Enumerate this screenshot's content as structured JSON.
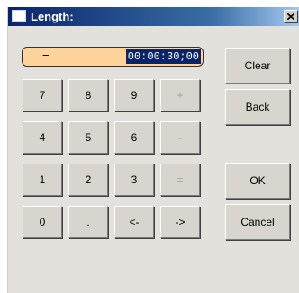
{
  "window": {
    "title": "Length:"
  },
  "display": {
    "operator": "=",
    "value": "00:00:30;00"
  },
  "keypad": {
    "row1": [
      {
        "label": "7",
        "enabled": true
      },
      {
        "label": "8",
        "enabled": true
      },
      {
        "label": "9",
        "enabled": true
      },
      {
        "label": "+",
        "enabled": false
      }
    ],
    "row2": [
      {
        "label": "4",
        "enabled": true
      },
      {
        "label": "5",
        "enabled": true
      },
      {
        "label": "6",
        "enabled": true
      },
      {
        "label": "-",
        "enabled": false
      }
    ],
    "row3": [
      {
        "label": "1",
        "enabled": true
      },
      {
        "label": "2",
        "enabled": true
      },
      {
        "label": "3",
        "enabled": true
      },
      {
        "label": "=",
        "enabled": false
      }
    ],
    "row4": [
      {
        "label": "0",
        "enabled": true
      },
      {
        "label": ".",
        "enabled": true
      },
      {
        "label": "<-",
        "enabled": true
      },
      {
        "label": "->",
        "enabled": true
      }
    ]
  },
  "actions": {
    "clear": "Clear",
    "back": "Back",
    "ok": "OK",
    "cancel": "Cancel"
  },
  "colors": {
    "display_bg": "#ffd39b",
    "selection_bg": "#0a246a",
    "titlebar_start": "#0a246a",
    "titlebar_end": "#a6caf0"
  }
}
